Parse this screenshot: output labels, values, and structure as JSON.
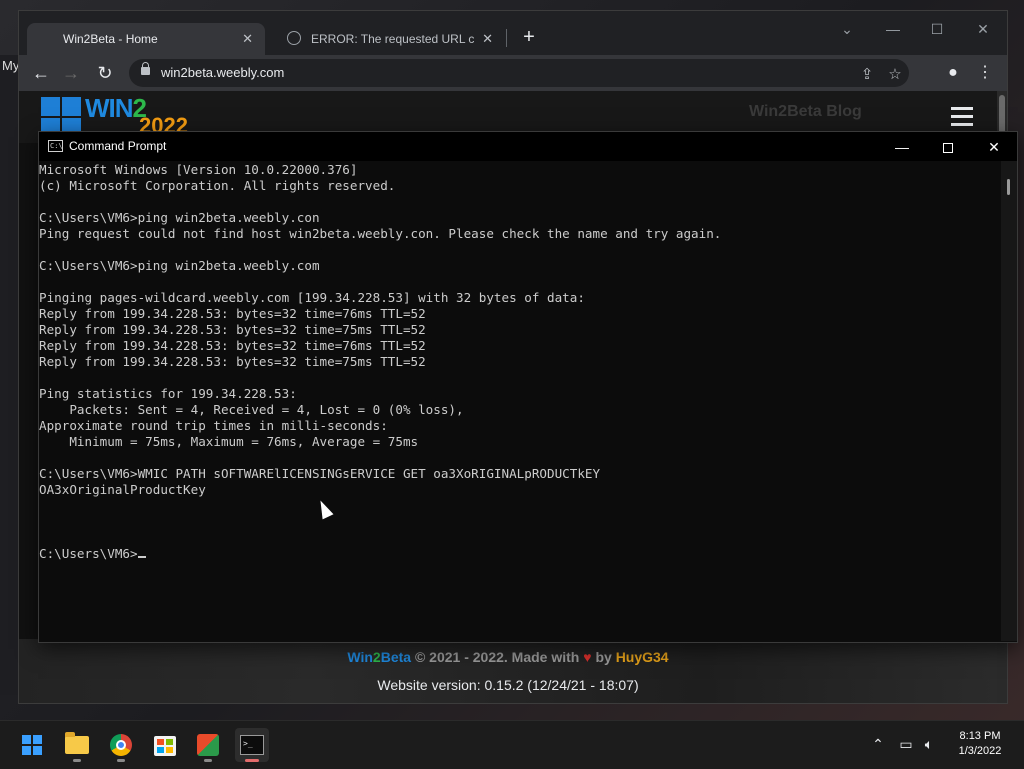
{
  "desktop": {
    "label": "My"
  },
  "browser": {
    "tabs": [
      {
        "label": "Win2Beta - Home",
        "active": true
      },
      {
        "label": "ERROR: The requested URL could",
        "active": false
      }
    ],
    "new_tab_symbol": "+",
    "url": "win2beta.weebly.com",
    "icons": {
      "back": "arrow-left-icon",
      "forward": "arrow-right-icon",
      "reload": "reload-icon",
      "share": "share-icon",
      "bookmark": "star-icon",
      "profile": "person-icon",
      "menu": "kebab-menu-icon"
    }
  },
  "site": {
    "logo_text_a": "WIN",
    "logo_text_b": "2",
    "logo_year": "2022",
    "brand_faded": "Win2Beta Blog",
    "footer": {
      "brand_a": "Win",
      "brand_b": "2",
      "brand_c": "Beta",
      "copyright": " © 2021 - 2022. Made with ",
      "heart": "♥",
      "by": " by ",
      "author": "HuyG34",
      "version": "Website version: 0.15.2 (12/24/21 - 18:07)"
    }
  },
  "cmd": {
    "title": "Command Prompt",
    "lines": [
      "Microsoft Windows [Version 10.0.22000.376]",
      "(c) Microsoft Corporation. All rights reserved.",
      "",
      "C:\\Users\\VM6>ping win2beta.weebly.con",
      "Ping request could not find host win2beta.weebly.con. Please check the name and try again.",
      "",
      "C:\\Users\\VM6>ping win2beta.weebly.com",
      "",
      "Pinging pages-wildcard.weebly.com [199.34.228.53] with 32 bytes of data:",
      "Reply from 199.34.228.53: bytes=32 time=76ms TTL=52",
      "Reply from 199.34.228.53: bytes=32 time=75ms TTL=52",
      "Reply from 199.34.228.53: bytes=32 time=76ms TTL=52",
      "Reply from 199.34.228.53: bytes=32 time=75ms TTL=52",
      "",
      "Ping statistics for 199.34.228.53:",
      "    Packets: Sent = 4, Received = 4, Lost = 0 (0% loss),",
      "Approximate round trip times in milli-seconds:",
      "    Minimum = 75ms, Maximum = 76ms, Average = 75ms",
      "",
      "C:\\Users\\VM6>WMIC PATH sOFTWARElICENSINGsERVICE GET oa3XoRIGINALpRODUCTkEY",
      "OA3xOriginalProductKey",
      "",
      "",
      "",
      "C:\\Users\\VM6>"
    ]
  },
  "taskbar": {
    "apps": [
      "windows-start",
      "file-explorer",
      "chrome",
      "microsoft-store",
      "office",
      "command-prompt"
    ],
    "time": "8:13 PM",
    "date": "1/3/2022"
  }
}
